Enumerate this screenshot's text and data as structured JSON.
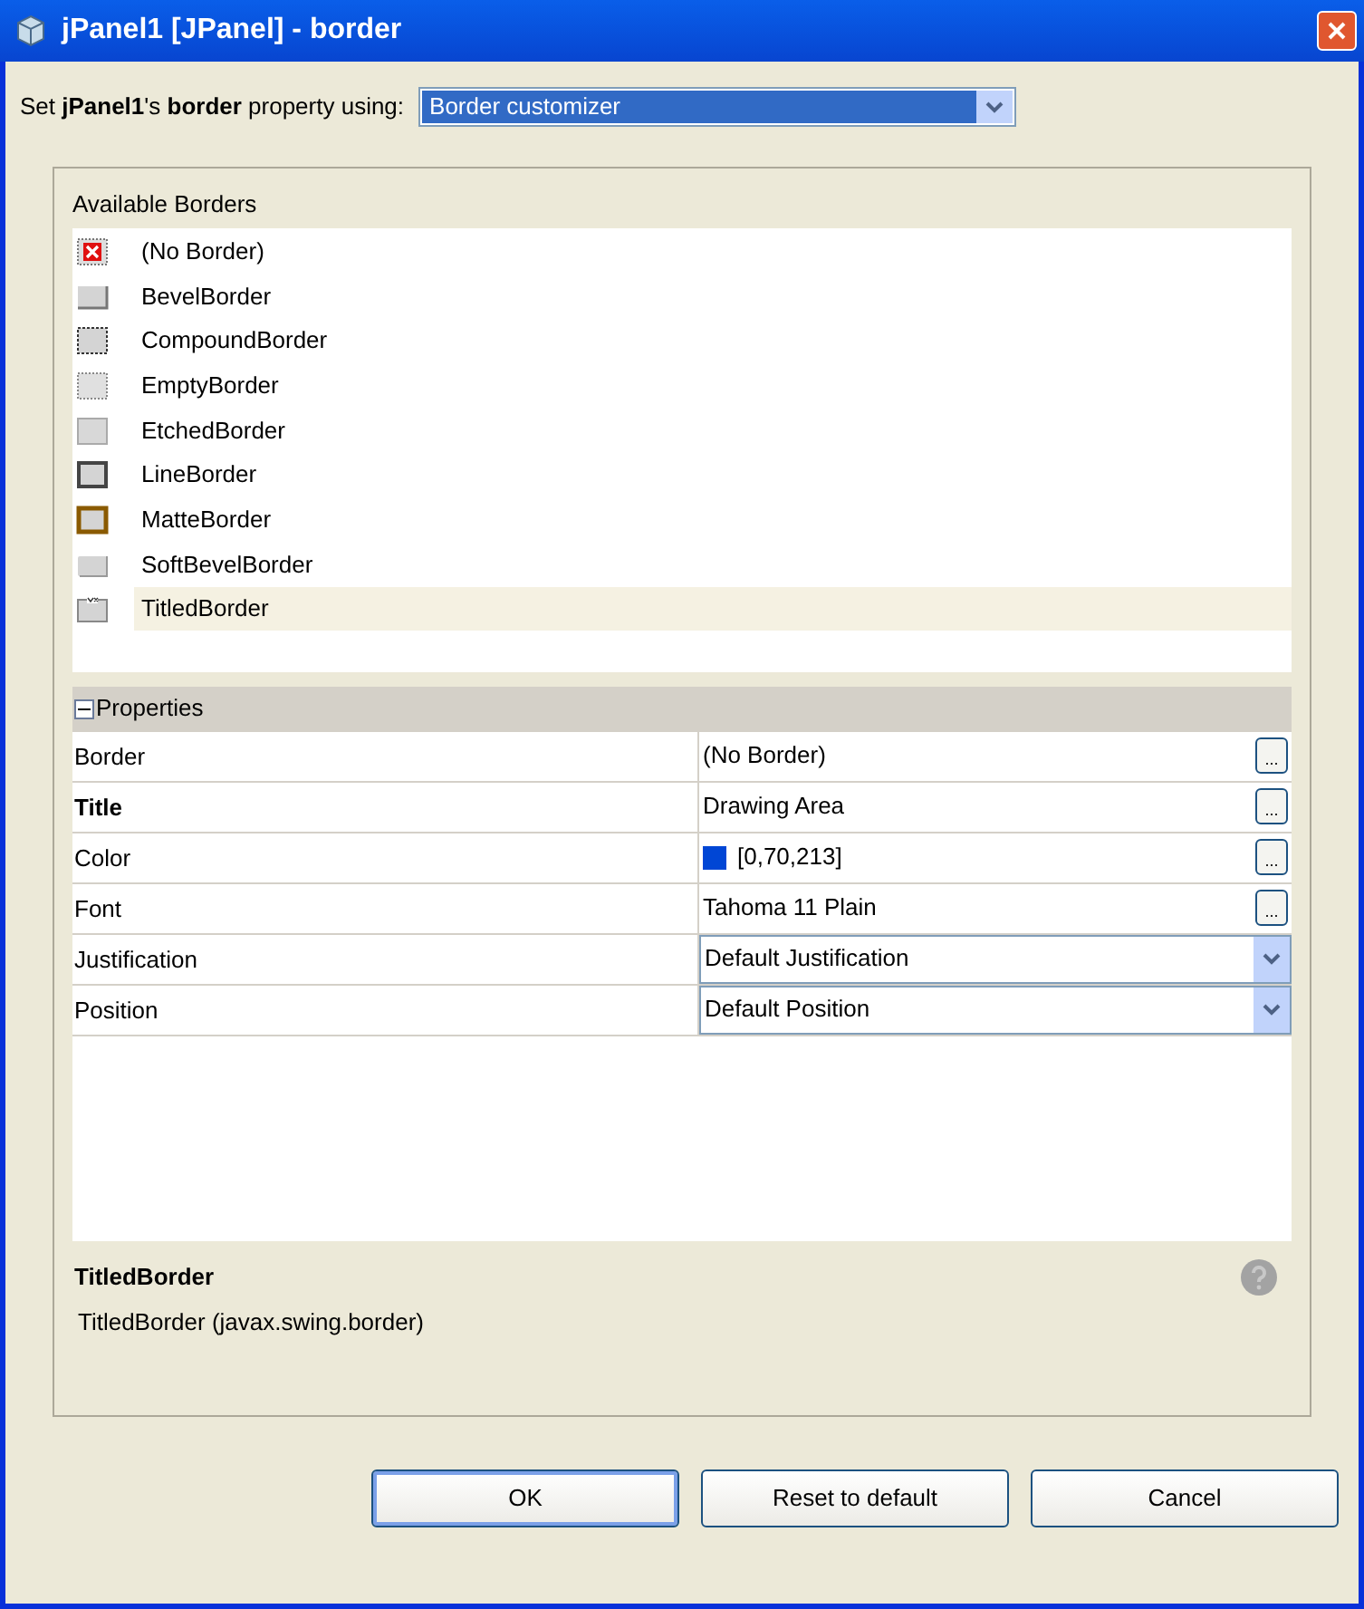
{
  "window": {
    "title": "jPanel1 [JPanel] - border"
  },
  "prompt": {
    "label": "Set **jPanel1**'s **border** property using:",
    "value": "Border customizer"
  },
  "borders": {
    "heading": "Available Borders",
    "items": [
      {
        "label": "(No Border)",
        "kind": "none",
        "selected": false
      },
      {
        "label": "BevelBorder",
        "kind": "bevel",
        "selected": false
      },
      {
        "label": "CompoundBorder",
        "kind": "compound",
        "selected": false
      },
      {
        "label": "EmptyBorder",
        "kind": "empty",
        "selected": false
      },
      {
        "label": "EtchedBorder",
        "kind": "etched",
        "selected": false
      },
      {
        "label": "LineBorder",
        "kind": "line",
        "selected": false
      },
      {
        "label": "MatteBorder",
        "kind": "matte",
        "selected": false
      },
      {
        "label": "SoftBevelBorder",
        "kind": "softbevel",
        "selected": false
      },
      {
        "label": "TitledBorder",
        "kind": "titled",
        "selected": true
      }
    ]
  },
  "properties": {
    "heading": "Properties",
    "expanded": true,
    "rows": [
      {
        "name": "Border",
        "value": "(No Border)",
        "kind": "button",
        "button": "...",
        "bold": false
      },
      {
        "name": "Title",
        "value": "Drawing Area",
        "kind": "button",
        "button": "...",
        "bold": true
      },
      {
        "name": "Color",
        "value": "[0,70,213]",
        "kind": "button",
        "button": "...",
        "bold": false,
        "color": "#0046d5"
      },
      {
        "name": "Font",
        "value": "Tahoma 11 Plain",
        "kind": "button",
        "button": "...",
        "bold": false
      },
      {
        "name": "Justification",
        "value": "Default Justification",
        "kind": "dropdown",
        "bold": false
      },
      {
        "name": "Position",
        "value": "Default Position",
        "kind": "dropdown",
        "bold": false
      }
    ]
  },
  "description": {
    "title": "TitledBorder",
    "text": "TitledBorder (javax.swing.border)"
  },
  "buttons": [
    "OK",
    "Reset to default",
    "Cancel"
  ]
}
